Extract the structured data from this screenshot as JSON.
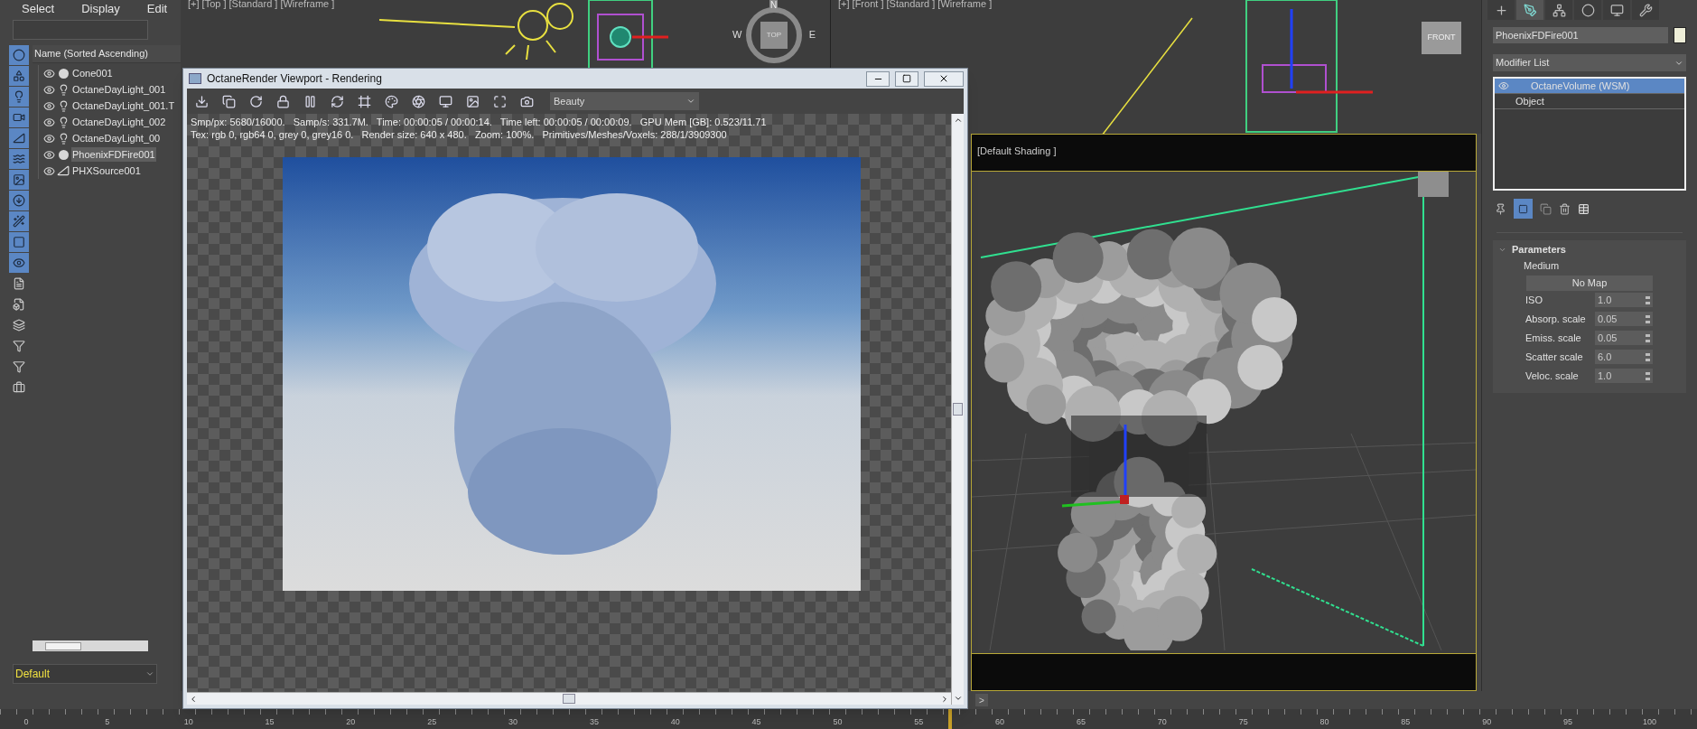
{
  "outliner": {
    "menu": [
      "Select",
      "Display",
      "Edit"
    ],
    "filter_toggles": [
      {
        "on": true
      },
      {
        "on": true
      },
      {
        "on": true
      },
      {
        "on": true
      },
      {
        "on": true
      },
      {
        "on": true
      },
      {
        "on": true
      },
      {
        "on": true
      },
      {
        "on": true
      },
      {
        "on": true
      },
      {
        "on": true
      },
      {
        "on": false
      },
      {
        "on": false
      },
      {
        "on": false
      },
      {
        "on": false
      },
      {
        "on": false
      },
      {
        "on": false
      }
    ],
    "header": "Name (Sorted Ascending)",
    "items": [
      {
        "label": "Cone001",
        "kind": "geometry",
        "selected": false
      },
      {
        "label": "OctaneDayLight_001",
        "kind": "light",
        "selected": false
      },
      {
        "label": "OctaneDayLight_001.T",
        "kind": "light",
        "selected": false
      },
      {
        "label": "OctaneDayLight_002",
        "kind": "light",
        "selected": false
      },
      {
        "label": "OctaneDayLight_00",
        "kind": "light",
        "selected": false
      },
      {
        "label": "PhoenixFDFire001",
        "kind": "geometry",
        "selected": true
      },
      {
        "label": "PHXSource001",
        "kind": "helper",
        "selected": false
      }
    ],
    "layer_dropdown": {
      "value": "Default"
    }
  },
  "viewports": {
    "top": {
      "label": "[+] [Top ] [Standard ] [Wireframe ]",
      "compass": {
        "north": "N",
        "west": "W",
        "east": "E",
        "cube": "TOP"
      }
    },
    "front": {
      "label": "[+] [Front ] [Standard ] [Wireframe ]",
      "cube": "FRONT"
    },
    "perspective": {
      "label": "[Default Shading ]"
    }
  },
  "render_window": {
    "title": "OctaneRender Viewport - Rendering",
    "pass_dropdown": {
      "value": "Beauty"
    },
    "stats": [
      "Smp/px: 5680/16000.   Samp/s: 331.7M.   Time: 00:00:05 / 00:00:14.   Time left: 00:00:05 / 00:00:09.   GPU Mem [GB]: 0.523/11.71",
      "Tex: rgb 0, rgb64 0, grey 0, grey16 0.   Render size: 640 x 480.   Zoom: 100%.   Primitives/Meshes/Voxels: 288/1/3909300"
    ]
  },
  "command_panel": {
    "tabs": [
      {
        "selected": false
      },
      {
        "selected": true
      },
      {
        "selected": false
      },
      {
        "selected": false
      },
      {
        "selected": false
      },
      {
        "selected": false
      }
    ],
    "object_name": "PhoenixFDFire001",
    "modifier_list": "Modifier List",
    "stack": [
      {
        "label": "OctaneVolume (WSM)",
        "selected": true,
        "visible": true
      },
      {
        "label": "Object",
        "selected": false
      }
    ],
    "rollout": {
      "title": "Parameters",
      "expanded": true,
      "medium_label": "Medium",
      "map_button": "No Map",
      "params": [
        {
          "label": "ISO",
          "value": "1.0"
        },
        {
          "label": "Absorp. scale",
          "value": "0.05"
        },
        {
          "label": "Emiss. scale",
          "value": "0.05"
        },
        {
          "label": "Scatter scale",
          "value": "6.0"
        },
        {
          "label": "Veloc. scale",
          "value": "1.0"
        }
      ]
    }
  },
  "time_slider": {
    "next_button": ">"
  },
  "timeline": {
    "ticks": [
      "0",
      "5",
      "10",
      "15",
      "20",
      "25",
      "30",
      "35",
      "40",
      "45",
      "50",
      "55",
      "60",
      "65",
      "70",
      "75",
      "80",
      "85",
      "90",
      "95",
      "100"
    ]
  }
}
